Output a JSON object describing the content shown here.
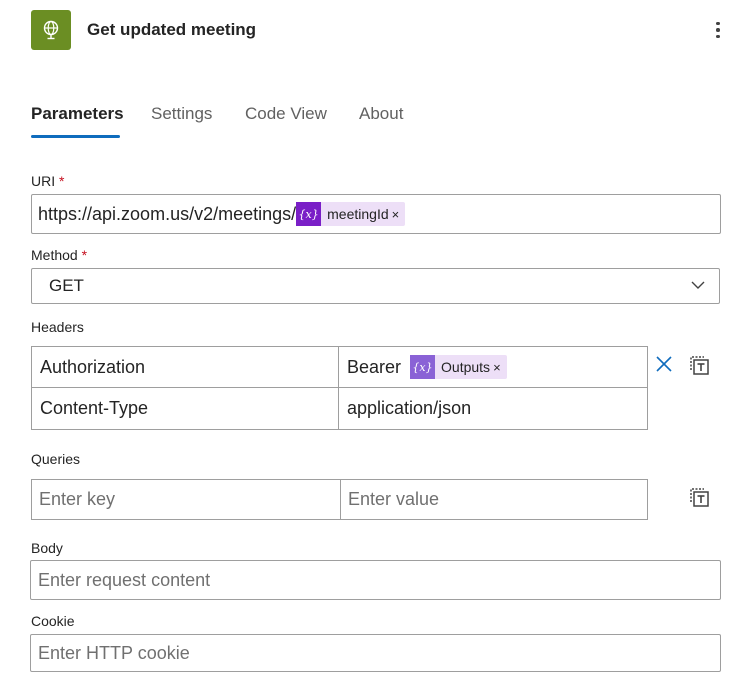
{
  "header": {
    "title": "Get updated meeting",
    "app_icon": "globe-icon",
    "icon_color": "#6b8e23"
  },
  "tabs": [
    {
      "label": "Parameters",
      "active": true
    },
    {
      "label": "Settings",
      "active": false
    },
    {
      "label": "Code View",
      "active": false
    },
    {
      "label": "About",
      "active": false
    }
  ],
  "uri": {
    "label": "URI",
    "required_mark": "*",
    "value": "https://api.zoom.us/v2/meetings/",
    "token": {
      "label": "meetingId",
      "icon": "{x}",
      "icon_color": "#7a1fc7"
    }
  },
  "method": {
    "label": "Method",
    "required_mark": "*",
    "value": "GET"
  },
  "headers": {
    "label": "Headers",
    "rows": [
      {
        "key": "Authorization",
        "value_prefix": "Bearer",
        "token": {
          "label": "Outputs",
          "icon": "{x}",
          "icon_color": "#8a62d6"
        }
      },
      {
        "key": "Content-Type",
        "value": "application/json"
      }
    ]
  },
  "queries": {
    "label": "Queries",
    "key_placeholder": "Enter key",
    "value_placeholder": "Enter value"
  },
  "body": {
    "label": "Body",
    "placeholder": "Enter request content"
  },
  "cookie": {
    "label": "Cookie",
    "placeholder": "Enter HTTP cookie"
  },
  "colors": {
    "accent": "#0f6cbd",
    "required": "#c50f1f",
    "token_bg": "#eddff7"
  }
}
